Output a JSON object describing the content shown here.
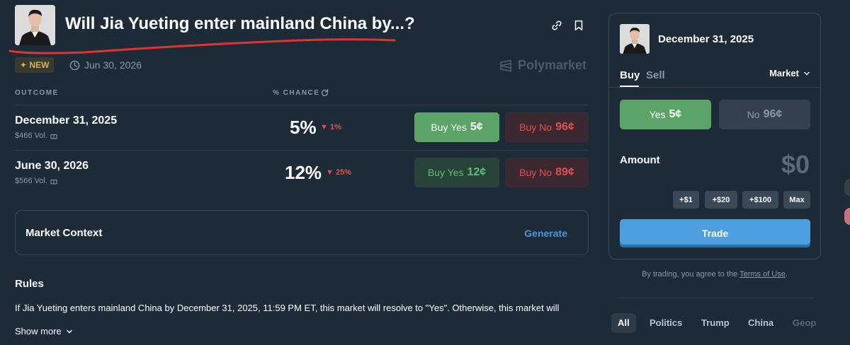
{
  "header": {
    "title": "Will Jia Yueting enter mainland China by...?",
    "badge": "NEW",
    "badge_icon": "sparkle-icon",
    "end_date": "Jun 30, 2026",
    "brand": "Polymarket"
  },
  "table": {
    "col_outcome": "OUTCOME",
    "col_chance": "% CHANCE",
    "rows": [
      {
        "date": "December 31, 2025",
        "volume": "$466 Vol.",
        "chance": "5%",
        "change": "1%",
        "change_direction": "down",
        "buy_yes_label": "Buy Yes",
        "buy_yes_price": "5¢",
        "buy_no_label": "Buy No",
        "buy_no_price": "96¢"
      },
      {
        "date": "June 30, 2026",
        "volume": "$566 Vol.",
        "chance": "12%",
        "change": "25%",
        "change_direction": "down",
        "buy_yes_label": "Buy Yes",
        "buy_yes_price": "12¢",
        "buy_no_label": "Buy No",
        "buy_no_price": "89¢"
      }
    ]
  },
  "context": {
    "label": "Market Context",
    "action": "Generate"
  },
  "rules": {
    "heading": "Rules",
    "text": "If Jia Yueting enters mainland China by December 31, 2025, 11:59 PM ET, this market will resolve to \"Yes\". Otherwise, this market will",
    "show_more": "Show more"
  },
  "panel": {
    "title": "December 31, 2025",
    "tab_buy": "Buy",
    "tab_sell": "Sell",
    "order_type": "Market",
    "yes_label": "Yes",
    "yes_price": "5¢",
    "no_label": "No",
    "no_price": "96¢",
    "amount_label": "Amount",
    "amount_value": "$0",
    "quick_amounts": [
      "+$1",
      "+$20",
      "+$100",
      "Max"
    ],
    "trade_label": "Trade"
  },
  "terms": {
    "prefix": "By trading, you agree to the",
    "link": "Terms of Use",
    "suffix": "."
  },
  "categories": [
    "All",
    "Politics",
    "Trump",
    "China",
    "Geop"
  ],
  "colors": {
    "background": "#1d2b39",
    "yes_green": "#5aa468",
    "no_red": "#e0524c",
    "accent_blue": "#4c9ede",
    "underline_red": "#e0342e"
  }
}
